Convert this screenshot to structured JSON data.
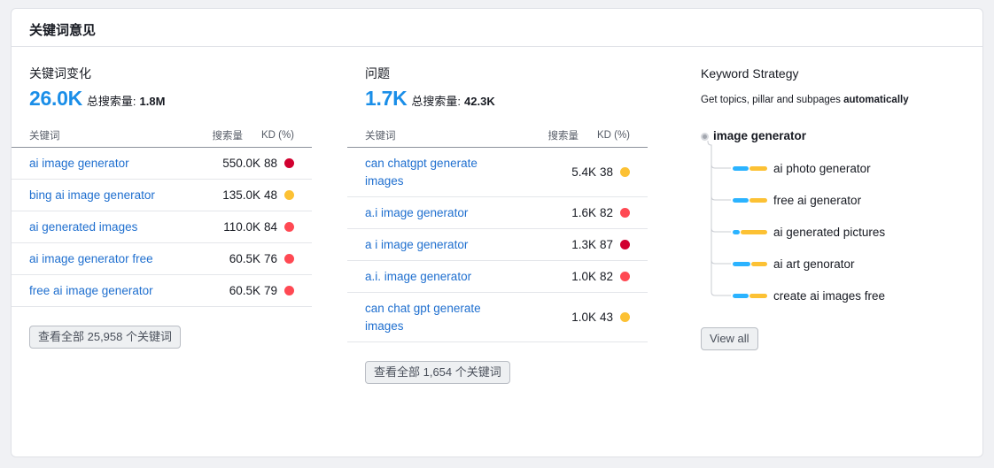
{
  "card": {
    "title": "关键词意见"
  },
  "variations": {
    "title": "关键词变化",
    "count": "26.0K",
    "total_label": "总搜索量:",
    "total_value": "1.8M",
    "headers": {
      "keyword": "关键词",
      "volume": "搜索量",
      "kd": "KD (%)"
    },
    "rows": [
      {
        "keyword": "ai image generator",
        "volume": "550.0K",
        "kd": "88",
        "kd_color": "#d1002f"
      },
      {
        "keyword": "bing ai image generator",
        "volume": "135.0K",
        "kd": "48",
        "kd_color": "#fcc134"
      },
      {
        "keyword": "ai generated images",
        "volume": "110.0K",
        "kd": "84",
        "kd_color": "#ff4953"
      },
      {
        "keyword": "ai image generator free",
        "volume": "60.5K",
        "kd": "76",
        "kd_color": "#ff4953"
      },
      {
        "keyword": "free ai image generator",
        "volume": "60.5K",
        "kd": "79",
        "kd_color": "#ff4953"
      }
    ],
    "button": "查看全部 25,958 个关键词"
  },
  "questions": {
    "title": "问题",
    "count": "1.7K",
    "total_label": "总搜索量:",
    "total_value": "42.3K",
    "headers": {
      "keyword": "关键词",
      "volume": "搜索量",
      "kd": "KD (%)"
    },
    "rows": [
      {
        "keyword": "can chatgpt generate images",
        "volume": "5.4K",
        "kd": "38",
        "kd_color": "#fcc134"
      },
      {
        "keyword": "a.i image generator",
        "volume": "1.6K",
        "kd": "82",
        "kd_color": "#ff4953"
      },
      {
        "keyword": "a i image generator",
        "volume": "1.3K",
        "kd": "87",
        "kd_color": "#d1002f"
      },
      {
        "keyword": "a.i. image generator",
        "volume": "1.0K",
        "kd": "82",
        "kd_color": "#ff4953"
      },
      {
        "keyword": "can chat gpt generate images",
        "volume": "1.0K",
        "kd": "43",
        "kd_color": "#fcc134"
      }
    ],
    "button": "查看全部 1,654 个关键词"
  },
  "strategy": {
    "title": "Keyword Strategy",
    "subtitle_prefix": "Get topics, pillar and subpages",
    "subtitle_bold": "automatically",
    "root": "image generator",
    "children": [
      {
        "label": "ai photo generator",
        "blue_share": 0.45
      },
      {
        "label": "free ai generator",
        "blue_share": 0.45
      },
      {
        "label": "ai generated pictures",
        "blue_share": 0.2
      },
      {
        "label": "ai art genorator",
        "blue_share": 0.5
      },
      {
        "label": "create ai images free",
        "blue_share": 0.45
      }
    ],
    "button": "View all",
    "colors": {
      "blue": "#2bb3ff",
      "yellow": "#fcc134"
    }
  }
}
